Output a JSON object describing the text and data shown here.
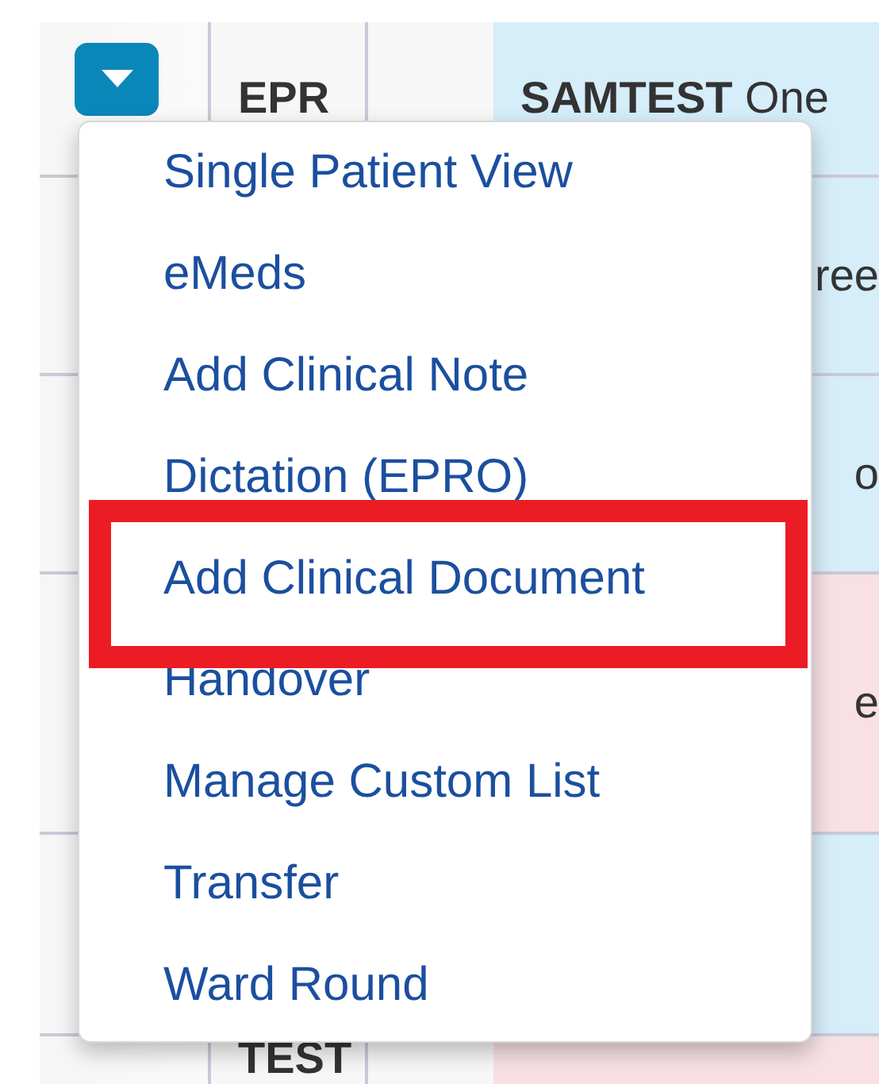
{
  "rows": [
    {
      "color": "#d6edfa",
      "has_button": true,
      "id_text": "EPR",
      "name": {
        "kind": "full",
        "text": "**SAMTEST** One"
      }
    },
    {
      "color": "#d6edfa",
      "has_button": false,
      "name": {
        "kind": "partial",
        "text": "ree"
      }
    },
    {
      "color": "#d6edfa",
      "has_button": false,
      "name": {
        "kind": "partial",
        "text": "o"
      }
    },
    {
      "color": "#f8e0e4",
      "has_button": false,
      "name": {
        "kind": "partial",
        "text": "e"
      }
    },
    {
      "color": "#d6edfa",
      "has_button": false
    },
    {
      "color": "#f8e0e4",
      "has_button": false,
      "id_text": "TEST"
    }
  ],
  "menu": {
    "items": [
      {
        "label": "Single Patient View",
        "highlighted": false
      },
      {
        "label": "eMeds",
        "highlighted": false
      },
      {
        "label": "Add Clinical Note",
        "highlighted": false
      },
      {
        "label": "Dictation (EPRO)",
        "highlighted": false
      },
      {
        "label": "Add Clinical Document",
        "highlighted": true
      },
      {
        "label": "Handover",
        "highlighted": false
      },
      {
        "label": "Manage Custom List",
        "highlighted": false
      },
      {
        "label": "Transfer",
        "highlighted": false
      },
      {
        "label": "Ward Round",
        "highlighted": false
      }
    ]
  }
}
